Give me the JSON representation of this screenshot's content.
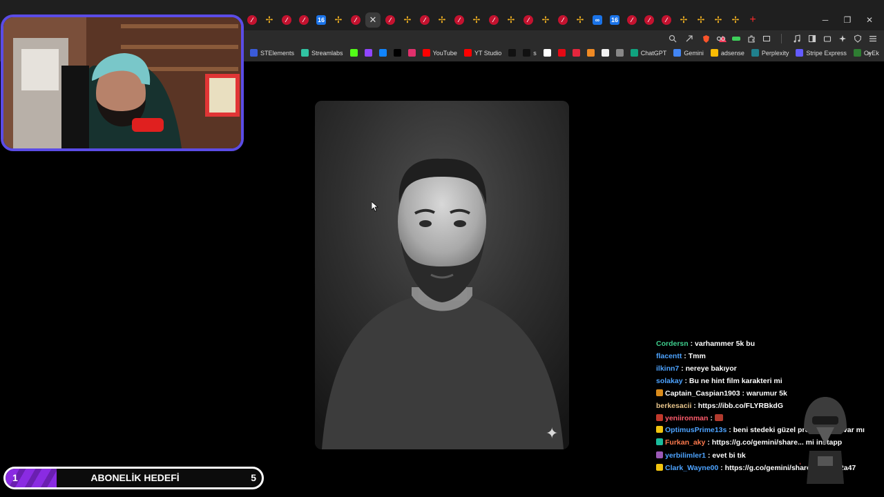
{
  "browser": {
    "tabs": [
      {
        "type": "red"
      },
      {
        "type": "pin"
      },
      {
        "type": "red"
      },
      {
        "type": "red"
      },
      {
        "type": "blue",
        "text": "16"
      },
      {
        "type": "pin"
      },
      {
        "type": "red"
      },
      {
        "type": "active",
        "text": "✕"
      },
      {
        "type": "red"
      },
      {
        "type": "pin"
      },
      {
        "type": "red"
      },
      {
        "type": "pin"
      },
      {
        "type": "red"
      },
      {
        "type": "pin"
      },
      {
        "type": "red"
      },
      {
        "type": "pin"
      },
      {
        "type": "red"
      },
      {
        "type": "pin"
      },
      {
        "type": "red"
      },
      {
        "type": "pin"
      },
      {
        "type": "blue",
        "text": "∞"
      },
      {
        "type": "blue",
        "text": "16"
      },
      {
        "type": "red"
      },
      {
        "type": "red"
      },
      {
        "type": "red"
      },
      {
        "type": "pin"
      },
      {
        "type": "pin"
      },
      {
        "type": "pin"
      },
      {
        "type": "pin"
      }
    ],
    "add_tab": "+",
    "window_controls": {
      "minimize": "─",
      "restore": "❐",
      "close": "✕"
    }
  },
  "bookmarks": [
    {
      "label": "STElements",
      "icon": "st-icon",
      "color": "#3a5bd9"
    },
    {
      "label": "Streamlabs",
      "icon": "streamlabs-icon",
      "color": "#31c3a2"
    },
    {
      "label": "",
      "icon": "kick-icon",
      "color": "#53fc18"
    },
    {
      "label": "",
      "icon": "twitch-icon",
      "color": "#9146ff"
    },
    {
      "label": "",
      "icon": "bluesky-icon",
      "color": "#1185fe"
    },
    {
      "label": "",
      "icon": "x-icon",
      "color": "#000000"
    },
    {
      "label": "",
      "icon": "instagram-icon",
      "color": "#e1306c"
    },
    {
      "label": "YouTube",
      "icon": "youtube-icon",
      "color": "#ff0000"
    },
    {
      "label": "YT Studio",
      "icon": "yt-studio-icon",
      "color": "#ff0000"
    },
    {
      "label": "",
      "icon": "tiktok-icon",
      "color": "#111111"
    },
    {
      "label": "s",
      "icon": "tiktok-icon",
      "color": "#111111"
    },
    {
      "label": "",
      "icon": "threads-icon",
      "color": "#ffffff"
    },
    {
      "label": "",
      "icon": "netflix-icon",
      "color": "#e50914"
    },
    {
      "label": "",
      "icon": "app-red-icon",
      "color": "#e5263d"
    },
    {
      "label": "",
      "icon": "app-orange-icon",
      "color": "#f08a24"
    },
    {
      "label": "",
      "icon": "app-white-icon",
      "color": "#f2f2f2"
    },
    {
      "label": "",
      "icon": "app-gray-icon",
      "color": "#888888"
    },
    {
      "label": "ChatGPT",
      "icon": "chatgpt-icon",
      "color": "#10a37f"
    },
    {
      "label": "Gemini",
      "icon": "gemini-icon",
      "color": "#4285f4"
    },
    {
      "label": "adsense",
      "icon": "adsense-icon",
      "color": "#fbbc04"
    },
    {
      "label": "Perplexity",
      "icon": "perplexity-icon",
      "color": "#20808d"
    },
    {
      "label": "Stripe Express",
      "icon": "stripe-icon",
      "color": "#635bff"
    },
    {
      "label": "OyEk",
      "icon": "oyek-icon",
      "color": "#2e7d32"
    }
  ],
  "bookmarks_more": "»",
  "goal": {
    "start": "1",
    "title": "ABONELİK HEDEFİ",
    "end": "5",
    "progress": 0.2
  },
  "chat": [
    {
      "user": "Cordersn",
      "color": "#3ecf8e",
      "text": "varhammer 5k bu",
      "badge": ""
    },
    {
      "user": "flacentt",
      "color": "#4da3ff",
      "text": "Tmm",
      "badge": ""
    },
    {
      "user": "ilkinn7",
      "color": "#4da3ff",
      "text": "nereye bakıyor",
      "badge": ""
    },
    {
      "user": "solakay",
      "color": "#4da3ff",
      "text": "Bu ne hint film karakteri mi",
      "badge": ""
    },
    {
      "user": "Captain_Caspian1903",
      "color": "#ffffff",
      "text": "warumur 5k",
      "badge": "#d98b1c"
    },
    {
      "user": "berkesacii",
      "color": "#e6c38a",
      "text": "https://ibb.co/FLYRBkdG",
      "badge": ""
    },
    {
      "user": "yeniironman",
      "color": "#ff5b6b",
      "text": "",
      "badge": "#c0392b",
      "emote": true
    },
    {
      "user": "OptimusPrime13s",
      "color": "#4da3ff",
      "text": "beni stedeki güzel pro... önerisi var mı",
      "badge": "#f1c40f",
      "wrap": true
    },
    {
      "user": "Furkan_aky",
      "color": "#ff7a4d",
      "text": "https://g.co/gemini/share... mi instapp",
      "badge": "#1abc9c",
      "wrap": true
    },
    {
      "user": "yerbilimler1",
      "color": "#4da3ff",
      "text": "evet bi tık",
      "badge": "#9b59b6"
    },
    {
      "user": "Clark_Wayne00",
      "color": "#4da3ff",
      "text": "https://g.co/gemini/share/3f695eb2a47",
      "badge": "#f1c40f"
    }
  ]
}
